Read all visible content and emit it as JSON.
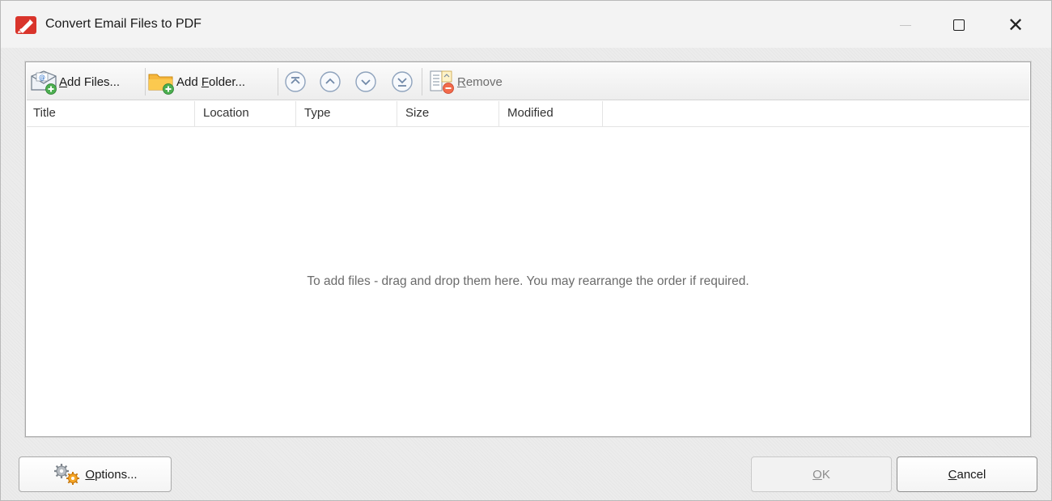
{
  "window": {
    "title": "Convert Email Files to PDF",
    "brand_color": "#d9342b"
  },
  "toolbar": {
    "add_files": {
      "pre": "",
      "mnemonic": "A",
      "post": "dd Files..."
    },
    "add_folder": {
      "pre": "Add ",
      "mnemonic": "F",
      "post": "older..."
    },
    "remove": {
      "pre": "",
      "mnemonic": "R",
      "post": "emove"
    },
    "nav_icons": [
      "move-to-top-icon",
      "move-up-icon",
      "move-down-icon",
      "move-to-bottom-icon"
    ]
  },
  "file_list": {
    "columns": [
      "Title",
      "Location",
      "Type",
      "Size",
      "Modified"
    ],
    "rows": [],
    "empty_hint": "To add files - drag and drop them here. You may rearrange the order if required."
  },
  "footer": {
    "options": {
      "pre": "",
      "mnemonic": "O",
      "post": "ptions..."
    },
    "ok": {
      "pre": "",
      "mnemonic": "O",
      "post": "K",
      "disabled": true
    },
    "cancel": {
      "pre": "",
      "mnemonic": "C",
      "post": "ancel"
    }
  }
}
